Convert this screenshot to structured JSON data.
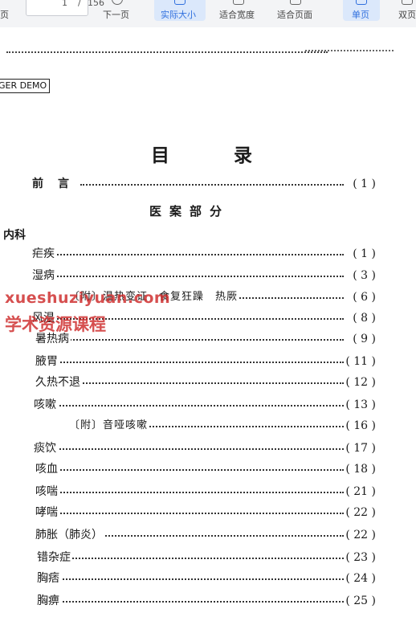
{
  "toolbar": {
    "prev_label": "页",
    "page_current": "1",
    "page_sep": "/",
    "page_total": "156",
    "next_label": "下一页",
    "actual_size_label": "实际大小",
    "fit_width_label": "适合宽度",
    "fit_page_label": "适合页面",
    "single_page_label": "单页",
    "double_page_label": "双页",
    "accent_color": "#2f6fde",
    "active_bg": "#dbe8fb"
  },
  "document": {
    "demo_label": "GER DEMO",
    "toc_title": "目 录",
    "preface": {
      "label": "前　言",
      "page": "( 1 )"
    },
    "section_title": "医案部分",
    "category": "内科",
    "entries": [
      {
        "label": "疟疾",
        "page": "( 1 )"
      },
      {
        "label": "湿病",
        "page": "( 3 )"
      },
      {
        "label": "〔附〕温热变证　食复狂躁　热厥",
        "page": "( 6 )"
      },
      {
        "label": "风温",
        "page": "( 8 )"
      },
      {
        "label": "暑热病",
        "page": "( 9 )"
      },
      {
        "label": "腋胃",
        "page": "( 11 )"
      },
      {
        "label": "久热不退",
        "page": "( 12 )"
      },
      {
        "label": "咳嗽",
        "page": "( 13 )"
      },
      {
        "label": "〔附〕音哑咳嗽",
        "page": "( 16 )"
      },
      {
        "label": "痰饮",
        "page": "( 17 )"
      },
      {
        "label": "咳血",
        "page": "( 18 )"
      },
      {
        "label": "咳喘",
        "page": "( 21 )"
      },
      {
        "label": "哮喘",
        "page": "( 22 )"
      },
      {
        "label": "肺胀（肺炎）",
        "page": "( 22 )"
      },
      {
        "label": "错杂症",
        "page": "( 23 )"
      },
      {
        "label": "胸痞",
        "page": "( 24 )"
      },
      {
        "label": "胸痹",
        "page": "( 25 )"
      }
    ]
  },
  "watermark": {
    "line1": "xueshuziyuan.com",
    "line2": "学术资源课程",
    "color": "#cd2828"
  }
}
